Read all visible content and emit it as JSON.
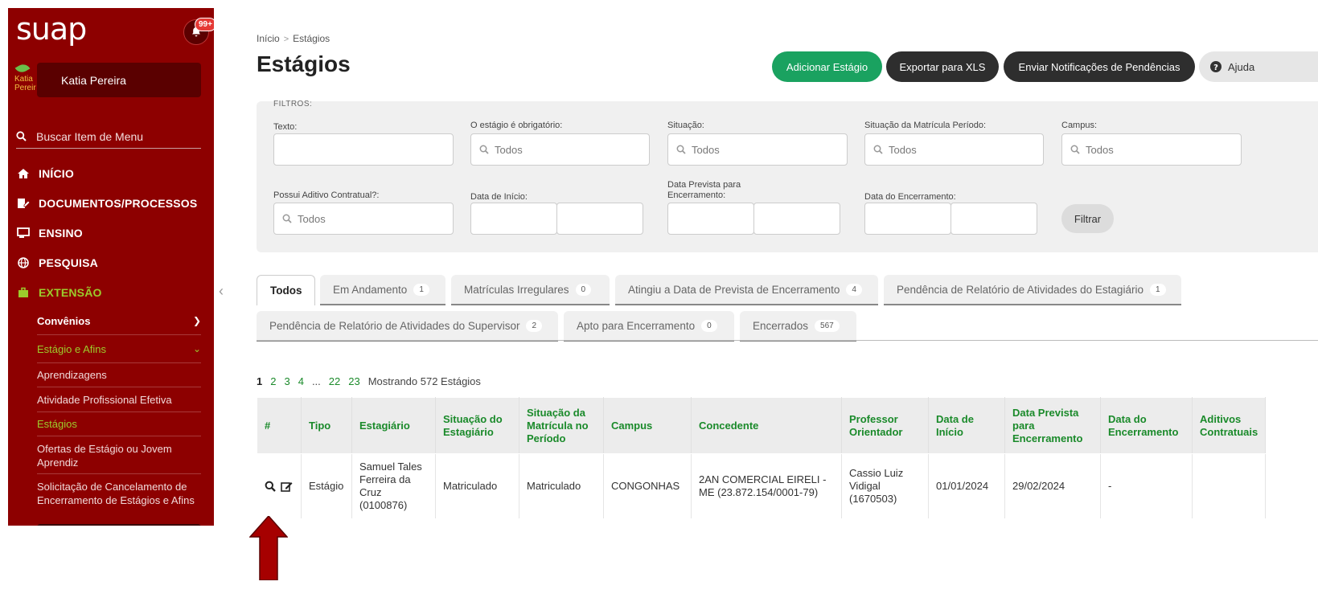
{
  "app": {
    "logo": "suap",
    "notif_badge": "99+"
  },
  "user": {
    "name": "Katia Pereira",
    "avatar_text": "Katia Pereir"
  },
  "sidebar": {
    "search_placeholder": "Buscar Item de Menu",
    "menu": [
      {
        "label": "INÍCIO",
        "icon": "home-icon"
      },
      {
        "label": "DOCUMENTOS/PROCESSOS",
        "icon": "document-edit-icon"
      },
      {
        "label": "ENSINO",
        "icon": "chalkboard-icon"
      },
      {
        "label": "PESQUISA",
        "icon": "globe-icon"
      },
      {
        "label": "EXTENSÃO",
        "icon": "briefcase-icon"
      }
    ],
    "sub": {
      "convenios": "Convênios",
      "estagio_afins": "Estágio e Afins",
      "items": [
        "Aprendizagens",
        "Atividade Profissional Efetiva",
        "Estágios",
        "Ofertas de Estágio ou Jovem Aprendiz",
        "Solicitação de Cancelamento de Encerramento de Estágios e Afins"
      ]
    }
  },
  "breadcrumb": {
    "home": "Início",
    "current": "Estágios"
  },
  "page": {
    "title": "Estágios"
  },
  "actions": {
    "add": "Adicionar Estágio",
    "export": "Exportar para XLS",
    "notify": "Enviar Notificações de Pendências",
    "help": "Ajuda"
  },
  "filters": {
    "title": "FILTROS:",
    "texto": "Texto:",
    "obrigatorio": "O estágio é obrigatório:",
    "situacao": "Situação:",
    "situacao_matricula": "Situação da Matrícula Período:",
    "campus": "Campus:",
    "aditivo": "Possui Aditivo Contratual?:",
    "data_inicio": "Data de Início:",
    "data_prevista": "Data Prevista para Encerramento:",
    "data_encerramento": "Data do Encerramento:",
    "todos": "Todos",
    "filtrar": "Filtrar"
  },
  "tabs": [
    {
      "label": "Todos",
      "count": ""
    },
    {
      "label": "Em Andamento",
      "count": "1"
    },
    {
      "label": "Matrículas Irregulares",
      "count": "0"
    },
    {
      "label": "Atingiu a Data de Prevista de Encerramento",
      "count": "4"
    },
    {
      "label": "Pendência de Relatório de Atividades do Estagiário",
      "count": "1"
    },
    {
      "label": "Pendência de Relatório de Atividades do Supervisor",
      "count": "2"
    },
    {
      "label": "Apto para Encerramento",
      "count": "0"
    },
    {
      "label": "Encerrados",
      "count": "567"
    }
  ],
  "pagination": {
    "pages": [
      "1",
      "2",
      "3",
      "4",
      "...",
      "22",
      "23"
    ],
    "summary": "Mostrando 572 Estágios"
  },
  "table": {
    "headers": [
      "#",
      "Tipo",
      "Estagiário",
      "Situação do Estagiário",
      "Situação da Matrícula no Período",
      "Campus",
      "Concedente",
      "Professor Orientador",
      "Data de Início",
      "Data Prevista para Encerramento",
      "Data do Encerramento",
      "Aditivos Contratuais"
    ],
    "rows": [
      [
        "",
        "Estágio",
        "Samuel Tales Ferreira da Cruz (0100876)",
        "Matriculado",
        "Matriculado",
        "CONGONHAS",
        "2AN COMERCIAL EIRELI - ME (23.872.154/0001-79)",
        "Cassio Luiz Vidigal (1670503)",
        "01/01/2024",
        "29/02/2024",
        "-",
        ""
      ]
    ]
  },
  "colors": {
    "sidebar": "#8d0000",
    "accent_green": "#1aa260",
    "link_green": "#1a8a2a",
    "arrow": "#a60000"
  }
}
